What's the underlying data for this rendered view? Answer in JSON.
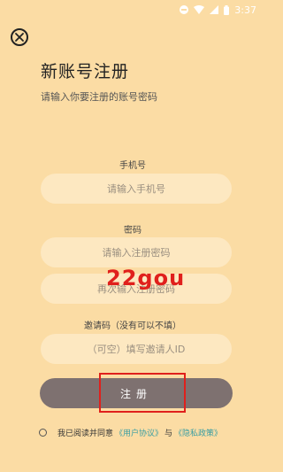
{
  "status_bar": {
    "time": "3:37",
    "icons": [
      "do-not-disturb-icon",
      "wifi-icon",
      "signal-icon",
      "battery-icon"
    ]
  },
  "close": {
    "icon": "close-circle-icon"
  },
  "header": {
    "title": "新账号注册",
    "subtitle": "请输入你要注册的账号密码"
  },
  "form": {
    "phone": {
      "label": "手机号",
      "placeholder": "请输入手机号"
    },
    "password": {
      "label": "密码",
      "placeholder": "请输入注册密码"
    },
    "confirm": {
      "placeholder": "再次输入注册密码"
    },
    "invite": {
      "label": "邀请码（没有可以不填）",
      "placeholder": "（可空）填写邀请人ID"
    },
    "submit_label": "注册"
  },
  "overlay": {
    "watermark": "22gou"
  },
  "agreement": {
    "prefix": "我已阅读并同意",
    "user_agreement": "《用户协议》",
    "and": "与",
    "privacy_policy": "《隐私政策》"
  },
  "colors": {
    "background": "#fbdca4",
    "input_bg": "#fde8c1",
    "button_bg": "#7e7170",
    "link": "#3a9ea3",
    "watermark": "#e0201c"
  }
}
